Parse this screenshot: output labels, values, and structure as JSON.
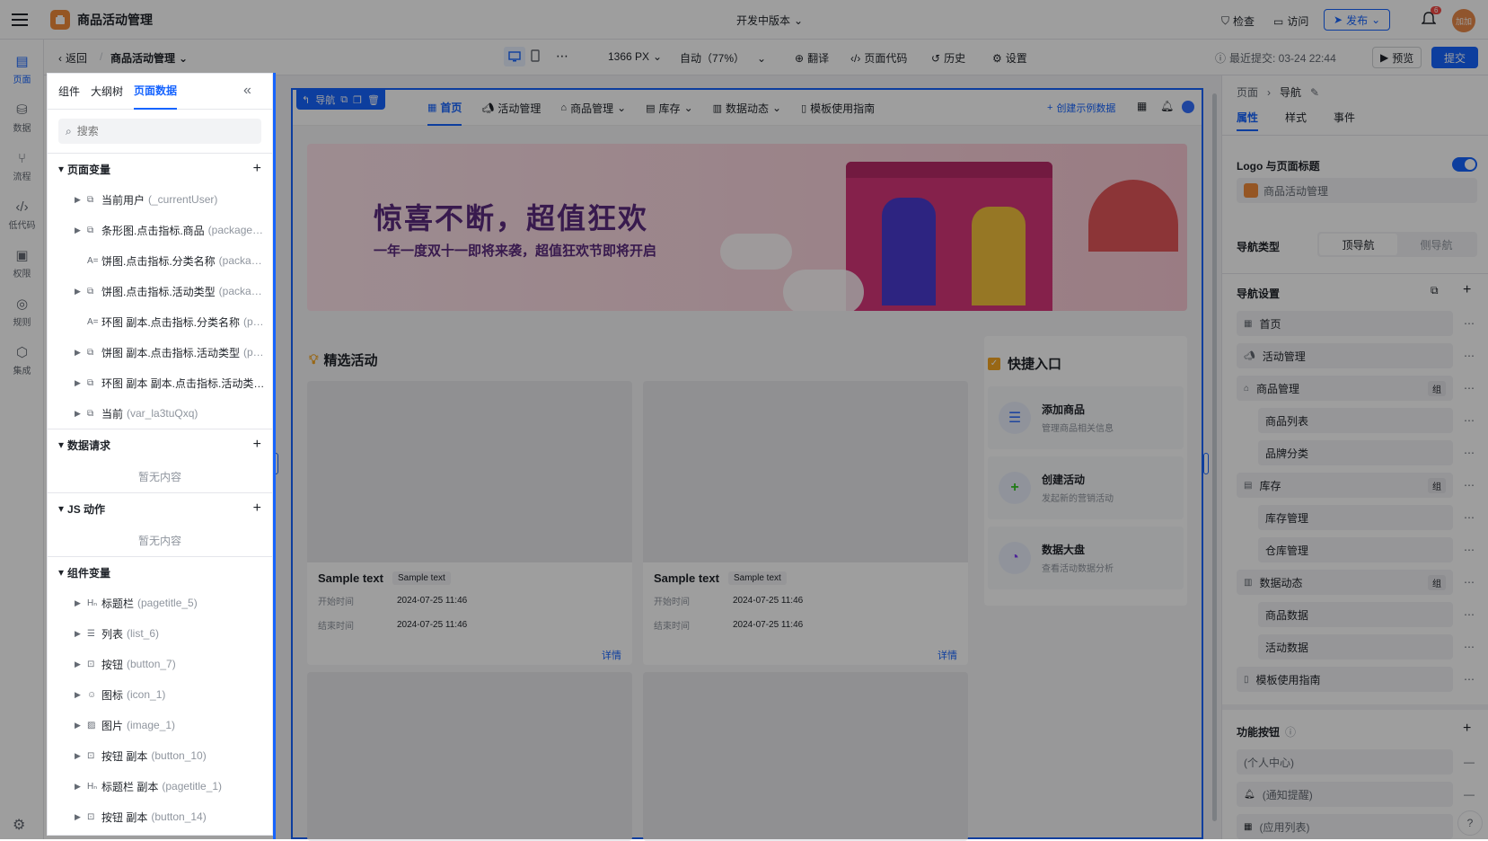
{
  "app": {
    "title": "商品活动管理",
    "version": "开发中版本"
  },
  "top_actions": {
    "check": "检查",
    "visit": "访问",
    "publish": "发布",
    "notify_count": "6",
    "avatar_text": "加加"
  },
  "toolbar": {
    "back": "返回",
    "page_select": "商品活动管理",
    "width": "1366 PX",
    "zoom": "自动（77%）",
    "translate": "翻译",
    "page_code": "页面代码",
    "history": "历史",
    "settings": "设置",
    "last_commit": "最近提交: 03-24 22:44",
    "preview": "预览",
    "submit": "提交"
  },
  "rail": [
    {
      "label": "页面",
      "icon": "page-icon"
    },
    {
      "label": "数据",
      "icon": "database-icon"
    },
    {
      "label": "流程",
      "icon": "flow-icon"
    },
    {
      "label": "低代码",
      "icon": "code-icon"
    },
    {
      "label": "权限",
      "icon": "lock-icon"
    },
    {
      "label": "规则",
      "icon": "rule-icon"
    },
    {
      "label": "集成",
      "icon": "integration-icon"
    }
  ],
  "panel": {
    "tabs": [
      "组件",
      "大纲树",
      "页面数据"
    ],
    "search_placeholder": "搜索",
    "page_vars_title": "页面变量",
    "page_vars": [
      {
        "name": "当前用户",
        "id": "(_currentUser)",
        "expand": true
      },
      {
        "name": "条形图.点击指标.商品",
        "id": "(package…",
        "expand": true
      },
      {
        "name": "饼图.点击指标.分类名称",
        "id": "(packa…",
        "expand": false
      },
      {
        "name": "饼图.点击指标.活动类型",
        "id": "(packa…",
        "expand": true
      },
      {
        "name": "环图 副本.点击指标.分类名称",
        "id": "(p…",
        "expand": false
      },
      {
        "name": "饼图 副本.点击指标.活动类型",
        "id": "(p…",
        "expand": true
      },
      {
        "name": "环图 副本 副本.点击指标.活动类…",
        "id": "",
        "expand": true
      },
      {
        "name": "当前",
        "id": "(var_la3tuQxq)",
        "expand": true
      }
    ],
    "data_req_title": "数据请求",
    "empty": "暂无内容",
    "js_title": "JS 动作",
    "comp_vars_title": "组件变量",
    "comp_vars": [
      {
        "name": "标题栏",
        "id": "(pagetitle_5)"
      },
      {
        "name": "列表",
        "id": "(list_6)"
      },
      {
        "name": "按钮",
        "id": "(button_7)"
      },
      {
        "name": "图标",
        "id": "(icon_1)"
      },
      {
        "name": "图片",
        "id": "(image_1)"
      },
      {
        "name": "按钮 副本",
        "id": "(button_10)"
      },
      {
        "name": "标题栏 副本",
        "id": "(pagetitle_1)"
      },
      {
        "name": "按钮 副本",
        "id": "(button_14)"
      }
    ]
  },
  "canvas": {
    "nav_tag": "导航",
    "nav_items": [
      "首页",
      "活动管理",
      "商品管理",
      "库存",
      "数据动态",
      "模板使用指南"
    ],
    "create_sample": "创建示例数据",
    "banner_title": "惊喜不断，超值狂欢",
    "banner_sub": "一年一度双十一即将来袭，超值狂欢节即将开启",
    "featured_title": "精选活动",
    "quick_title": "快捷入口",
    "cards": [
      {
        "title": "Sample text",
        "tag": "Sample text",
        "start_label": "开始时间",
        "start": "2024-07-25 11:46",
        "end_label": "结束时间",
        "end": "2024-07-25 11:46",
        "link": "详情"
      },
      {
        "title": "Sample text",
        "tag": "Sample text",
        "start_label": "开始时间",
        "start": "2024-07-25 11:46",
        "end_label": "结束时间",
        "end": "2024-07-25 11:46",
        "link": "详情"
      }
    ],
    "quick": [
      {
        "title": "添加商品",
        "sub": "管理商品相关信息",
        "color": "#3370ff"
      },
      {
        "title": "创建活动",
        "sub": "发起新的营销活动",
        "color": "#34c724"
      },
      {
        "title": "数据大盘",
        "sub": "查看活动数据分析",
        "color": "#7f3bf5"
      }
    ]
  },
  "right": {
    "crumb1": "页面",
    "crumb2": "导航",
    "tabs": [
      "属性",
      "样式",
      "事件"
    ],
    "logo_title_label": "Logo 与页面标题",
    "logo_title_value": "商品活动管理",
    "nav_type_label": "导航类型",
    "nav_type_options": [
      "顶导航",
      "侧导航"
    ],
    "nav_settings_label": "导航设置",
    "nav_items": [
      {
        "label": "首页",
        "level": 0,
        "group": ""
      },
      {
        "label": "活动管理",
        "level": 0,
        "group": ""
      },
      {
        "label": "商品管理",
        "level": 0,
        "group": "组"
      },
      {
        "label": "商品列表",
        "level": 1,
        "group": ""
      },
      {
        "label": "品牌分类",
        "level": 1,
        "group": ""
      },
      {
        "label": "库存",
        "level": 0,
        "group": "组"
      },
      {
        "label": "库存管理",
        "level": 1,
        "group": ""
      },
      {
        "label": "仓库管理",
        "level": 1,
        "group": ""
      },
      {
        "label": "数据动态",
        "level": 0,
        "group": "组"
      },
      {
        "label": "商品数据",
        "level": 1,
        "group": ""
      },
      {
        "label": "活动数据",
        "level": 1,
        "group": ""
      },
      {
        "label": "模板使用指南",
        "level": 0,
        "group": ""
      }
    ],
    "func_btn_label": "功能按钮",
    "func_items": [
      "(个人中心)",
      "(通知提醒)",
      "(应用列表)"
    ]
  },
  "colors": {
    "accent": "#1664ff",
    "orange": "#f5a623"
  }
}
